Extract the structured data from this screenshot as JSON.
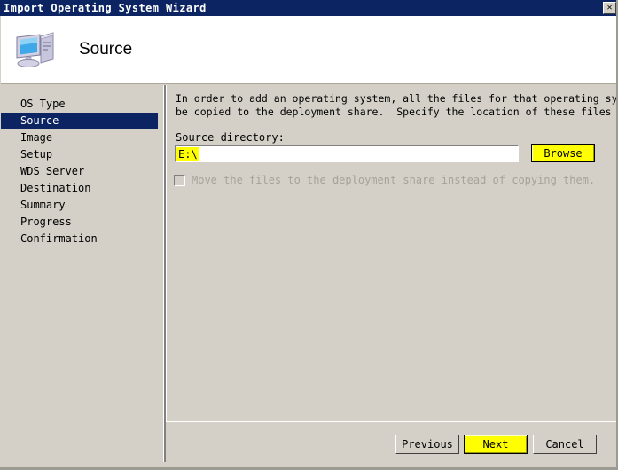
{
  "window": {
    "title": "Import Operating System Wizard",
    "close_label": "✕"
  },
  "header": {
    "title": "Source",
    "icon": "computer-icon"
  },
  "sidebar": {
    "items": [
      {
        "label": "OS Type",
        "selected": false
      },
      {
        "label": "Source",
        "selected": true
      },
      {
        "label": "Image",
        "selected": false
      },
      {
        "label": "Setup",
        "selected": false
      },
      {
        "label": "WDS Server",
        "selected": false
      },
      {
        "label": "Destination",
        "selected": false
      },
      {
        "label": "Summary",
        "selected": false
      },
      {
        "label": "Progress",
        "selected": false
      },
      {
        "label": "Confirmation",
        "selected": false
      }
    ]
  },
  "main": {
    "intro_line1": "In order to add an operating system, all the files for that operating system need to",
    "intro_line2": "be copied to the deployment share.  Specify the location of these files (typically a",
    "source_directory_label": "Source directory:",
    "source_directory_value": "E:\\",
    "browse_label": "Browse",
    "move_files_checkbox_label": "Move the files to the deployment share instead of copying them.",
    "move_files_checked": false,
    "move_files_enabled": false
  },
  "buttons": {
    "previous": "Previous",
    "next": "Next",
    "cancel": "Cancel"
  },
  "colors": {
    "titlebar": "#0c2461",
    "selection": "#0c2461",
    "highlight_yellow": "#ffff00",
    "face": "#d4d0c8",
    "disabled_text": "#a6a29a"
  }
}
